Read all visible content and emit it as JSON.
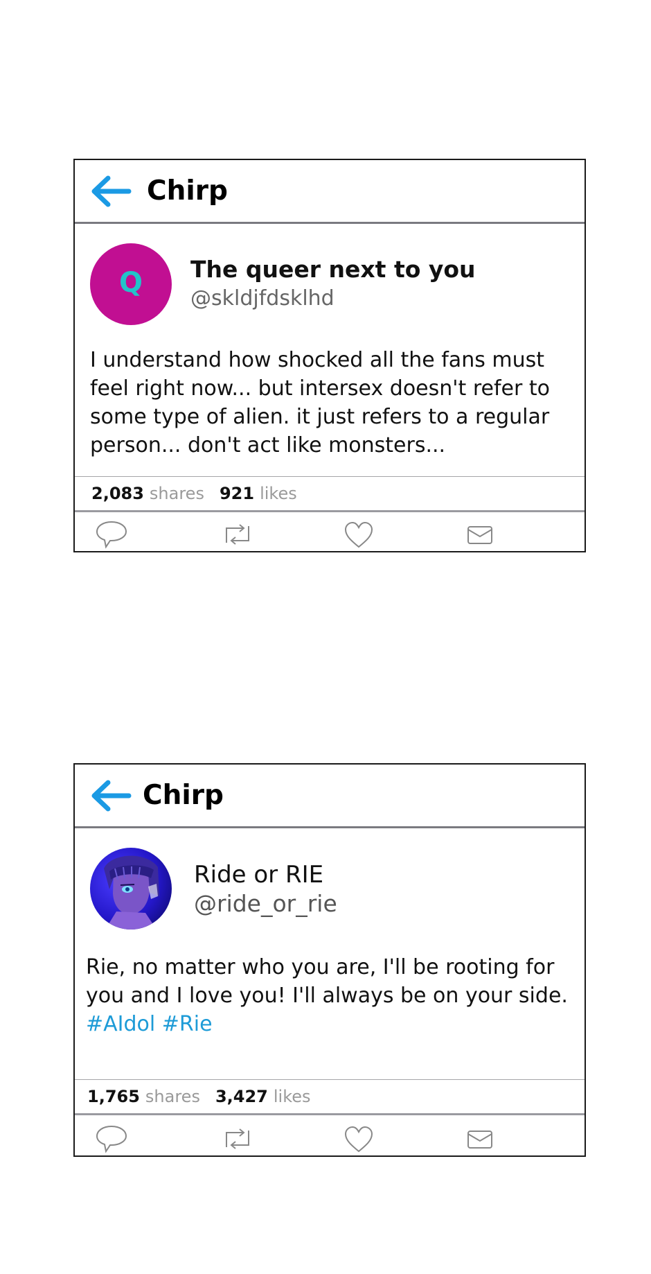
{
  "posts": [
    {
      "app_title": "Chirp",
      "avatar_letter": "Q",
      "avatar_color": "#c10f92",
      "avatar_letter_color": "#22c3c9",
      "display_name": "The queer next to you",
      "handle": "@skldjfdsklhd",
      "text": "I understand how shocked all the fans must feel right now... but intersex doesn't refer to some type of alien. it just refers to a regular person... don't act like monsters...",
      "hashtags": "",
      "shares_count": "2,083",
      "shares_label": "shares",
      "likes_count": "921",
      "likes_label": "likes"
    },
    {
      "app_title": "Chirp",
      "display_name": "Ride or RIE",
      "handle": "@ride_or_rie",
      "text": "Rie, no matter who you are, I'll be rooting for you and I love you! I'll always be on your side.",
      "hashtags": "#AIdol #Rie",
      "shares_count": "1,765",
      "shares_label": "shares",
      "likes_count": "3,427",
      "likes_label": "likes"
    }
  ],
  "icons": {
    "back": "arrow-left-icon",
    "reply": "speech-bubble-icon",
    "share": "retweet-icon",
    "like": "heart-icon",
    "message": "envelope-icon"
  },
  "colors": {
    "accent": "#1d9bd7",
    "back_arrow": "#1b9ae4"
  }
}
